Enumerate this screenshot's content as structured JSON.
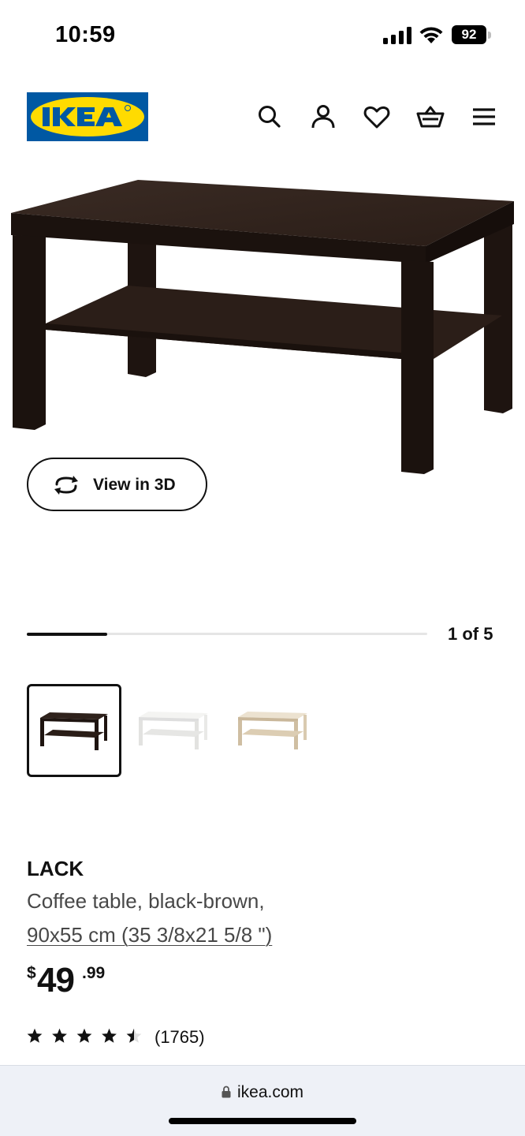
{
  "status_bar": {
    "time": "10:59",
    "battery_level": "92"
  },
  "header": {
    "logo_text": "IKEA",
    "icons": [
      "search-icon",
      "account-icon",
      "heart-icon",
      "basket-icon",
      "menu-icon"
    ]
  },
  "product_media": {
    "view_3d_label": "View in 3D",
    "image_counter": "1 of 5",
    "progress_fraction": 0.2,
    "thumbnails": [
      {
        "variant": "black-brown",
        "color": "#1e1410",
        "selected": true
      },
      {
        "variant": "white",
        "color": "#f1f1ee",
        "selected": false
      },
      {
        "variant": "white stained oak effect",
        "color": "#e3d6c0",
        "selected": false
      }
    ]
  },
  "product": {
    "name": "LACK",
    "description": "Coffee table, black-brown,",
    "size": "90x55 cm (35 3/8x21 5/8 \")",
    "price": {
      "currency": "$",
      "integer": "49",
      "decimal": ".99"
    },
    "rating": {
      "stars": 4.5,
      "review_count": "(1765)"
    }
  },
  "browser": {
    "url": "ikea.com"
  },
  "colors": {
    "brand_blue": "#0058a3",
    "brand_yellow": "#ffdb00",
    "text": "#111111",
    "secondary_text": "#484848"
  }
}
